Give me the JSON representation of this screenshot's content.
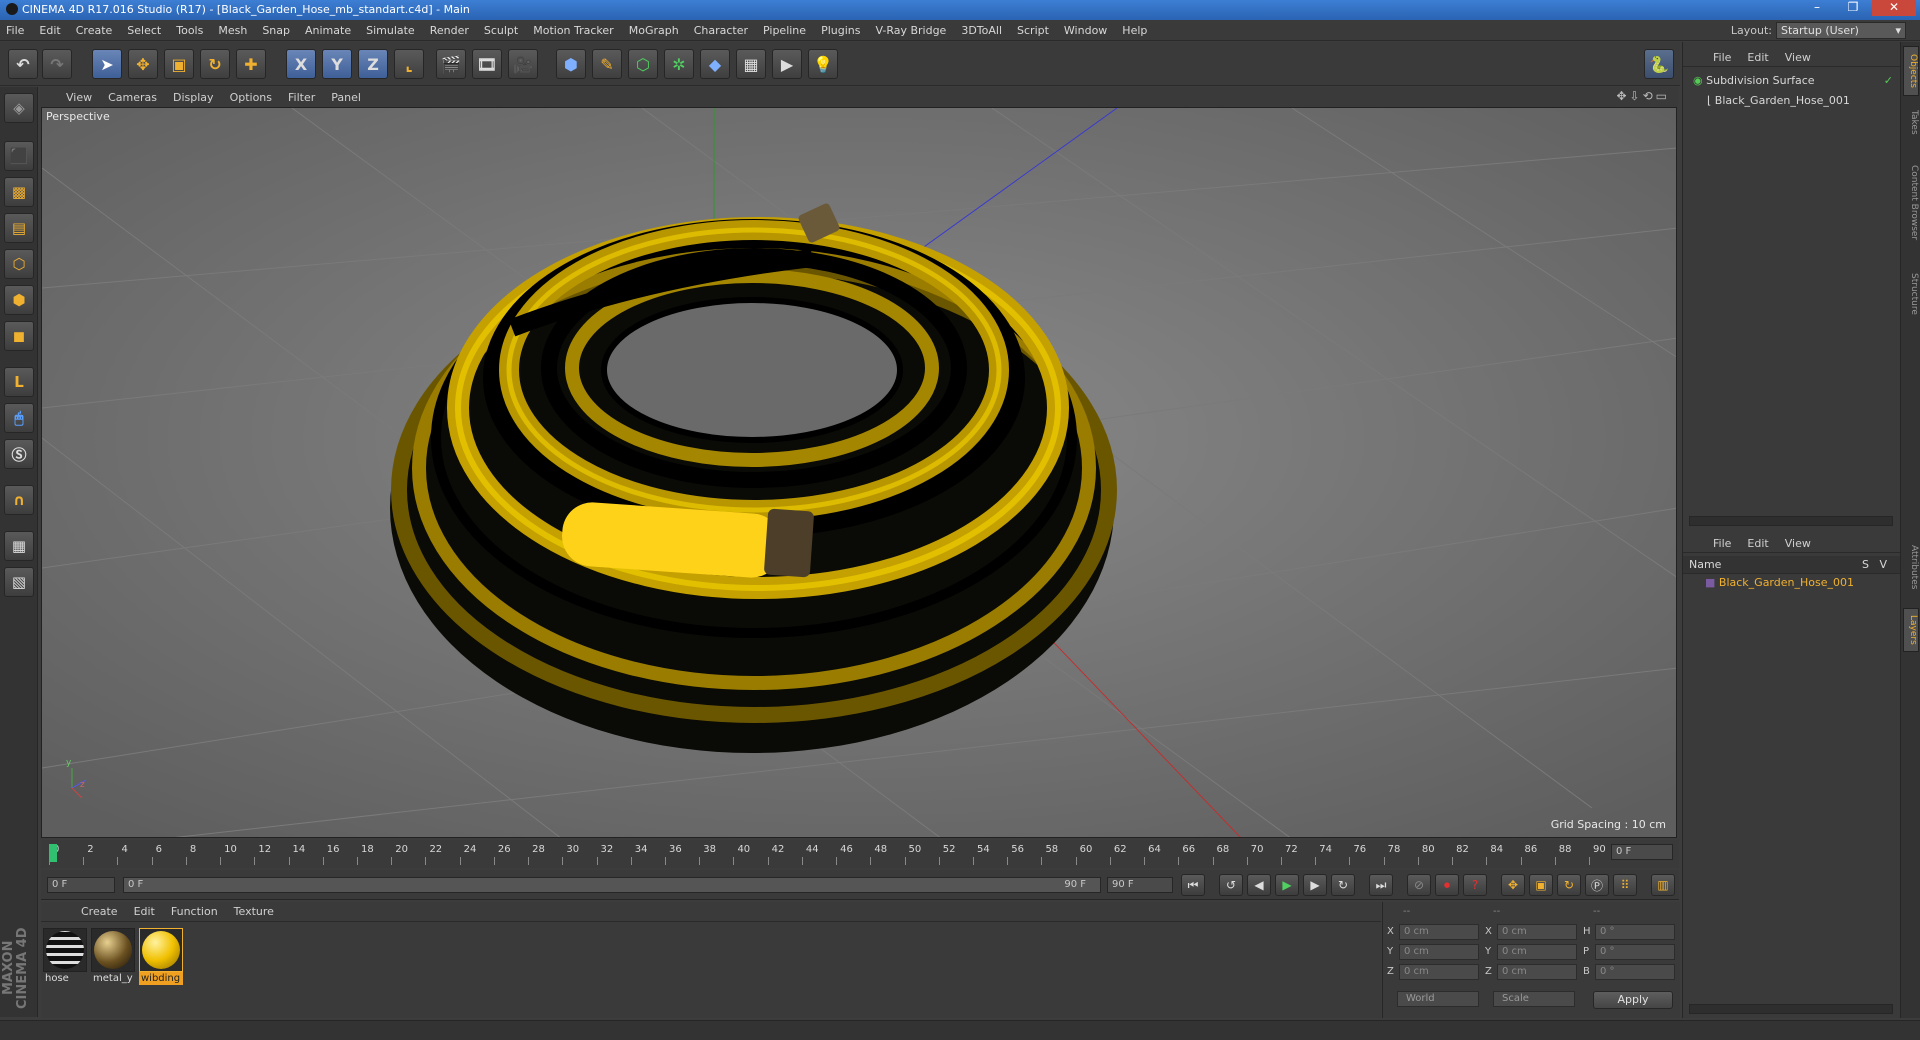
{
  "window": {
    "title": "CINEMA 4D R17.016 Studio (R17) - [Black_Garden_Hose_mb_standart.c4d] - Main",
    "minimize": "–",
    "maximize": "❐",
    "close": "✕"
  },
  "menu": [
    "File",
    "Edit",
    "Create",
    "Select",
    "Tools",
    "Mesh",
    "Snap",
    "Animate",
    "Simulate",
    "Render",
    "Sculpt",
    "Motion Tracker",
    "MoGraph",
    "Character",
    "Pipeline",
    "Plugins",
    "V-Ray Bridge",
    "3DToAll",
    "Script",
    "Window",
    "Help"
  ],
  "layout": {
    "label": "Layout:",
    "value": "Startup (User)"
  },
  "toolbar": {
    "undo": "↶",
    "redo": "↷",
    "x": "X",
    "y": "Y",
    "z": "Z"
  },
  "viewport": {
    "menu": [
      "View",
      "Cameras",
      "Display",
      "Options",
      "Filter",
      "Panel"
    ],
    "label": "Perspective",
    "grid_spacing": "Grid Spacing : 10 cm",
    "axis_y": "y",
    "axis_z": "z"
  },
  "timeline": {
    "ticks": [
      "0",
      "2",
      "4",
      "6",
      "8",
      "10",
      "12",
      "14",
      "16",
      "18",
      "20",
      "22",
      "24",
      "26",
      "28",
      "30",
      "32",
      "34",
      "36",
      "38",
      "40",
      "42",
      "44",
      "46",
      "48",
      "50",
      "52",
      "54",
      "56",
      "58",
      "60",
      "62",
      "64",
      "66",
      "68",
      "70",
      "72",
      "74",
      "76",
      "78",
      "80",
      "82",
      "84",
      "86",
      "88",
      "90"
    ],
    "current_frame": "0 F",
    "start": "0 F",
    "range_start": "0 F",
    "range_end": "90 F",
    "end": "90 F"
  },
  "materials": {
    "menu": [
      "Create",
      "Edit",
      "Function",
      "Texture"
    ],
    "items": [
      {
        "name": "hose"
      },
      {
        "name": "metal_y"
      },
      {
        "name": "wibding"
      }
    ]
  },
  "coords": {
    "header": [
      "--",
      "--",
      "--"
    ],
    "rows": [
      {
        "a": "X",
        "av": "0 cm",
        "b": "X",
        "bv": "0 cm",
        "c": "H",
        "cv": "0 °"
      },
      {
        "a": "Y",
        "av": "0 cm",
        "b": "Y",
        "bv": "0 cm",
        "c": "P",
        "cv": "0 °"
      },
      {
        "a": "Z",
        "av": "0 cm",
        "b": "Z",
        "bv": "0 cm",
        "c": "B",
        "cv": "0 °"
      }
    ],
    "space": "World",
    "mode": "Scale",
    "apply": "Apply"
  },
  "objects": {
    "menu": [
      "File",
      "Edit",
      "View"
    ],
    "items": [
      "Subdivision Surface",
      "Black_Garden_Hose_001"
    ]
  },
  "layers": {
    "menu": [
      "File",
      "Edit",
      "View"
    ],
    "col_name": "Name",
    "col_s": "S",
    "col_v": "V",
    "items": [
      "Black_Garden_Hose_001"
    ]
  },
  "side_tabs": [
    "Objects",
    "Takes",
    "Content Browser",
    "Structure",
    "Attributes",
    "Layers"
  ],
  "branding": "MAXON CINEMA 4D",
  "colors": {
    "accent": "#f0b030",
    "hose_yellow": "#c9a000",
    "hose_black": "#0c0c06",
    "sleeve": "#ffd21a"
  }
}
